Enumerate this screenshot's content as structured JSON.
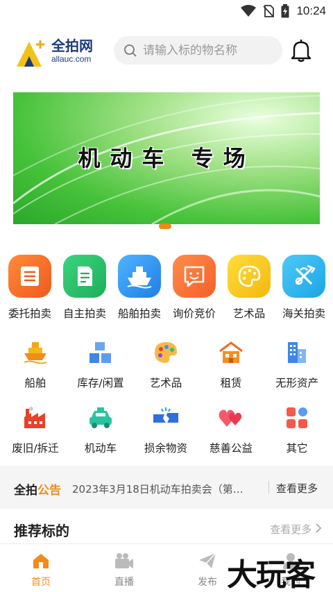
{
  "status_bar": {
    "time": "10:24"
  },
  "header": {
    "logo_cn": "全拍网",
    "logo_en": "allauc.com",
    "search_placeholder": "请输入标的物名称"
  },
  "banner": {
    "title": "机动车 专场"
  },
  "primary_categories": [
    {
      "label": "委托拍卖",
      "icon": "document-list-icon",
      "color": "#f4772a"
    },
    {
      "label": "自主拍卖",
      "icon": "document-icon",
      "color": "#27c46d"
    },
    {
      "label": "船舶拍卖",
      "icon": "ship-icon",
      "color": "#2f9bf0"
    },
    {
      "label": "询价竞价",
      "icon": "chat-smile-icon",
      "color": "#f9783a"
    },
    {
      "label": "艺术品",
      "icon": "palette-icon",
      "color": "#f7cc1a"
    },
    {
      "label": "海关拍卖",
      "icon": "customs-icon",
      "color": "#29b5ee"
    }
  ],
  "secondary_categories_row1": [
    {
      "label": "船舶",
      "icon": "ship-icon"
    },
    {
      "label": "库存/闲置",
      "icon": "boxes-icon"
    },
    {
      "label": "艺术品",
      "icon": "palette-icon"
    },
    {
      "label": "租赁",
      "icon": "house-icon"
    },
    {
      "label": "无形资产",
      "icon": "buildings-icon"
    }
  ],
  "secondary_categories_row2": [
    {
      "label": "废旧/拆迁",
      "icon": "factory-icon"
    },
    {
      "label": "机动车",
      "icon": "taxi-icon"
    },
    {
      "label": "损余物资",
      "icon": "broken-icon"
    },
    {
      "label": "慈善公益",
      "icon": "hearts-icon"
    },
    {
      "label": "其它",
      "icon": "grid-icon"
    }
  ],
  "notice": {
    "brand_main": "全拍",
    "brand_accent": "公告",
    "text": "2023年3月18日机动车拍卖会（第…",
    "more": "查看更多"
  },
  "recommend": {
    "title": "推荐标的",
    "more": "查看更多"
  },
  "tabs": [
    {
      "label": "首页",
      "active": true
    },
    {
      "label": "直播",
      "active": false
    },
    {
      "label": "发布",
      "active": false
    },
    {
      "label": "我的",
      "active": false
    }
  ],
  "watermark": "大玩客"
}
